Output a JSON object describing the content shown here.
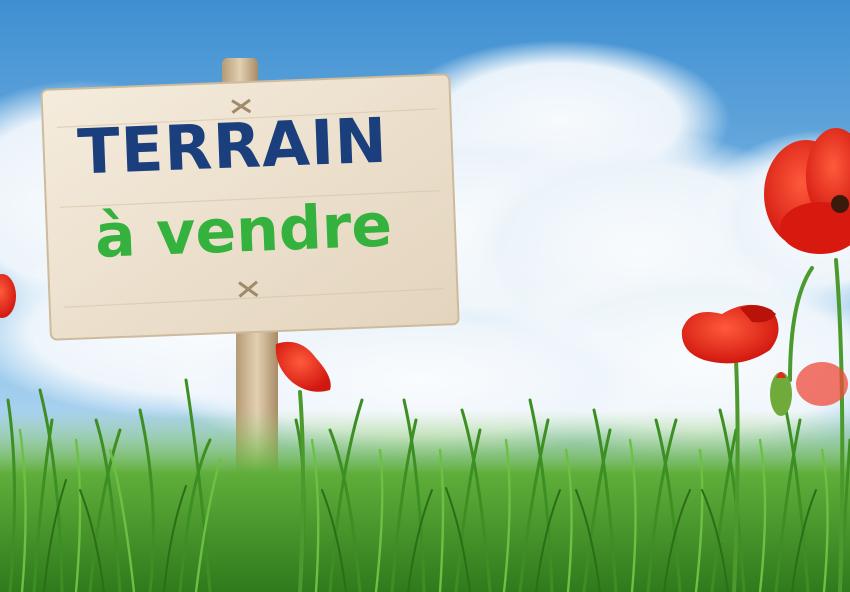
{
  "sign": {
    "line1": "TERRAIN",
    "line2": "à vendre",
    "line1_color": "#1b3f7c",
    "line2_color": "#35b13e"
  },
  "scene": {
    "sky_color": "#4d9bd6",
    "cloud_color": "#ffffff",
    "grass_color": "#3f9a2c",
    "poppy_color": "#e5281a",
    "board_color": "#efe4d2",
    "elements": [
      "sky",
      "clouds",
      "wooden-sign",
      "grass",
      "poppies"
    ]
  }
}
